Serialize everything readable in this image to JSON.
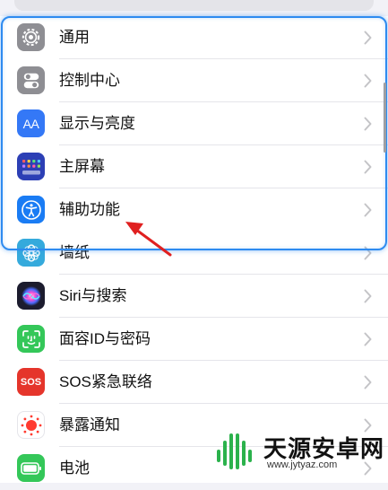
{
  "settings": {
    "items": [
      {
        "label": "通用",
        "icon": "gear-icon",
        "color": "#8e8e93"
      },
      {
        "label": "控制中心",
        "icon": "toggles-icon",
        "color": "#8e8e93"
      },
      {
        "label": "显示与亮度",
        "icon": "aa-text-icon",
        "icon_text": "AA",
        "color": "#3478f6"
      },
      {
        "label": "主屏幕",
        "icon": "app-grid-icon",
        "color": "#2c3fb5"
      },
      {
        "label": "辅助功能",
        "icon": "accessibility-icon",
        "color": "#1a7cf4"
      },
      {
        "label": "墙纸",
        "icon": "flower-icon",
        "color": "#35aadc"
      },
      {
        "label": "Siri与搜索",
        "icon": "siri-icon",
        "color": "#1c1c2e"
      },
      {
        "label": "面容ID与密码",
        "icon": "face-id-icon",
        "color": "#34c759"
      },
      {
        "label": "SOS紧急联络",
        "icon": "sos-icon",
        "icon_text": "SOS",
        "color": "#e5352b"
      },
      {
        "label": "暴露通知",
        "icon": "exposure-icon",
        "color": "#ff3b30"
      },
      {
        "label": "电池",
        "icon": "battery-icon",
        "color": "#34c759"
      }
    ]
  },
  "annotation": {
    "highlight_color": "#2e8bf0",
    "arrow_color": "#e02020",
    "arrow_target": "辅助功能"
  },
  "watermark": {
    "main_text": "天源安卓网",
    "url_text": "www.jytyaz.com"
  }
}
